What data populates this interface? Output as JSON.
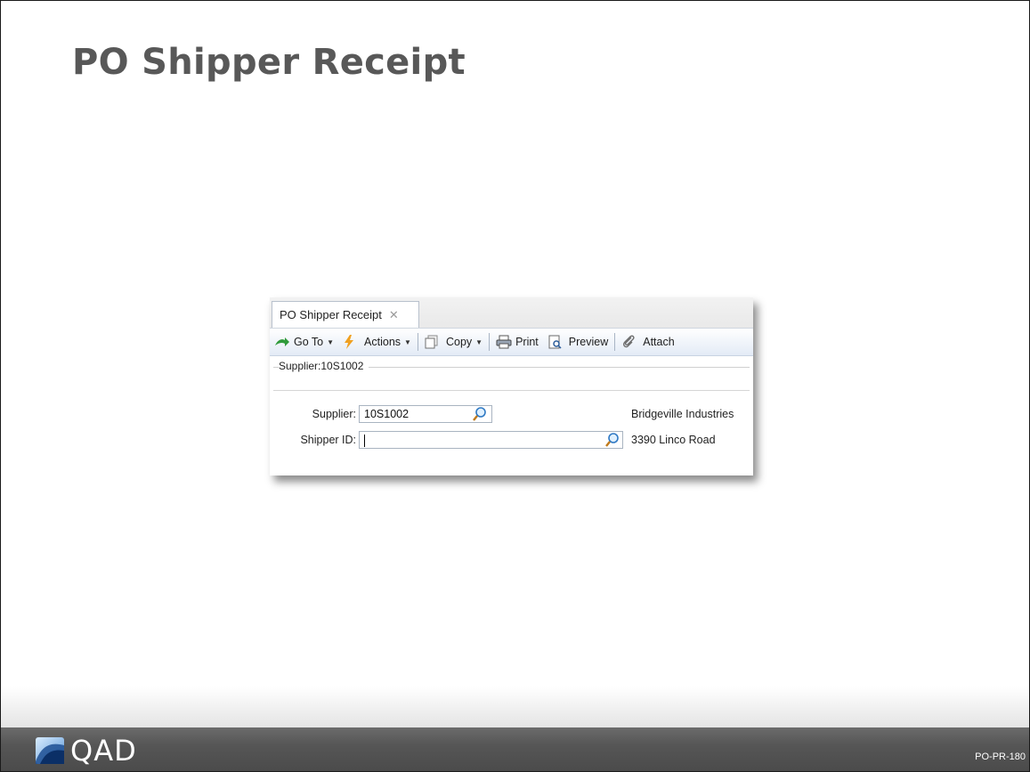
{
  "slide": {
    "title": "PO Shipper Receipt",
    "code": "PO-PR-180",
    "logo_text": "QAD"
  },
  "window": {
    "tab_label": "PO Shipper Receipt",
    "toolbar": {
      "goto": "Go To",
      "actions": "Actions",
      "copy": "Copy",
      "print": "Print",
      "preview": "Preview",
      "attach": "Attach"
    },
    "breadcrumb": "Supplier:10S1002",
    "fields": {
      "supplier_label": "Supplier:",
      "supplier_value": "10S1002",
      "supplier_name": "Bridgeville Industries",
      "shipper_label": "Shipper ID:",
      "shipper_value": "",
      "supplier_address": "3390 Linco Road"
    }
  },
  "colors": {
    "title": "#585858",
    "footer": "#565656",
    "toolbar_bg": "#e3ebf6"
  }
}
